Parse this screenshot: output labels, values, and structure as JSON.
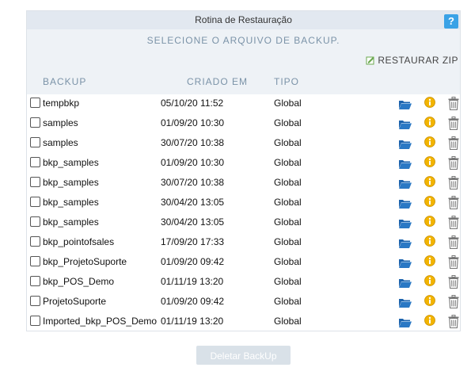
{
  "dialog": {
    "title": "Rotina de Restauração",
    "help_label": "?",
    "subtitle": "SELECIONE O ARQUIVO DE BACKUP.",
    "restore_zip_label": "RESTAURAR ZIP"
  },
  "table": {
    "headers": {
      "backup": "BACKUP",
      "created": "CRIADO EM",
      "type": "TIPO"
    },
    "rows": [
      {
        "name": "tempbkp",
        "date": "05/10/20 11:52",
        "type": "Global"
      },
      {
        "name": "samples",
        "date": "01/09/20 10:30",
        "type": "Global"
      },
      {
        "name": "samples",
        "date": "30/07/20 10:38",
        "type": "Global"
      },
      {
        "name": "bkp_samples",
        "date": "01/09/20 10:30",
        "type": "Global"
      },
      {
        "name": "bkp_samples",
        "date": "30/07/20 10:38",
        "type": "Global"
      },
      {
        "name": "bkp_samples",
        "date": "30/04/20 13:05",
        "type": "Global"
      },
      {
        "name": "bkp_samples",
        "date": "30/04/20 13:05",
        "type": "Global"
      },
      {
        "name": "bkp_pointofsales",
        "date": "17/09/20 17:33",
        "type": "Global"
      },
      {
        "name": "bkp_ProjetoSuporte",
        "date": "01/09/20 09:42",
        "type": "Global"
      },
      {
        "name": "bkp_POS_Demo",
        "date": "01/11/19 13:20",
        "type": "Global"
      },
      {
        "name": "ProjetoSuporte",
        "date": "01/09/20 09:42",
        "type": "Global"
      },
      {
        "name": "Imported_bkp_POS_Demo",
        "date": "01/11/19 13:20",
        "type": "Global"
      }
    ]
  },
  "actions": {
    "delete_label": "Deletar BackUp"
  },
  "icons": {
    "folder": "folder-open-icon",
    "info": "info-icon",
    "trash": "trash-icon",
    "zip": "zip-edit-icon"
  },
  "colors": {
    "help_bg": "#3aa2e6",
    "header_text": "#7b93a8",
    "folder": "#1c63ad",
    "info": "#f2b400",
    "button_disabled": "#d9e1e8"
  }
}
